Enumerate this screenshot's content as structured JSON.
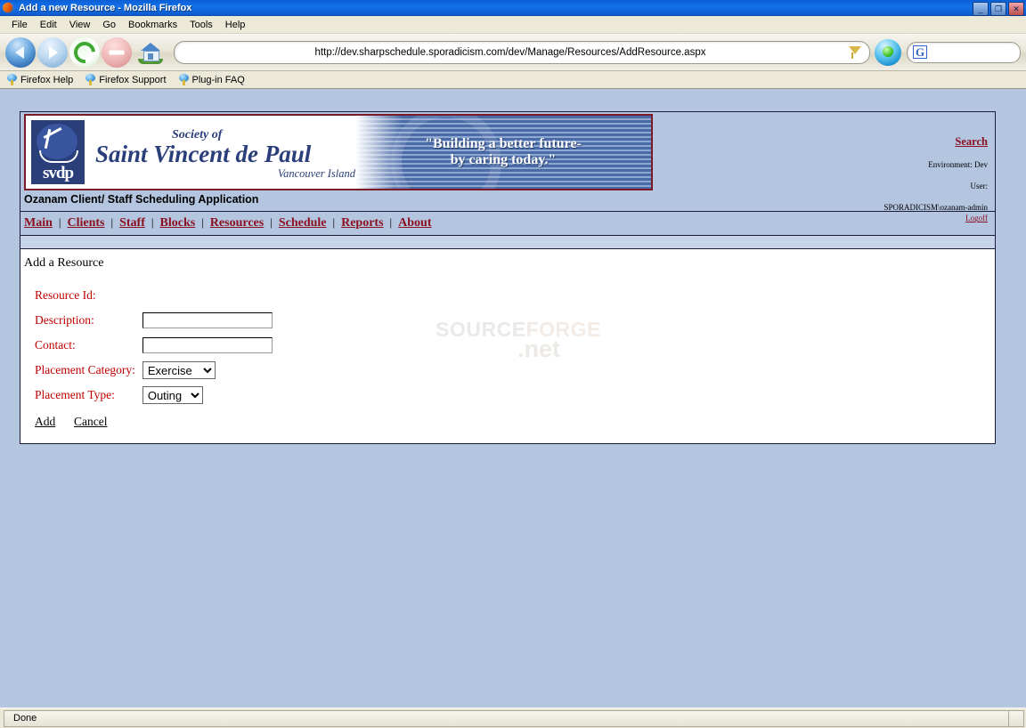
{
  "window": {
    "title": "Add a new Resource - Mozilla Firefox",
    "icon": "firefox-icon",
    "minimize": "_",
    "restore": "❐",
    "close": "✕"
  },
  "menubar": {
    "items": [
      "File",
      "Edit",
      "View",
      "Go",
      "Bookmarks",
      "Tools",
      "Help"
    ]
  },
  "toolbar": {
    "back": "back-button",
    "forward": "forward-button",
    "reload": "reload-button",
    "stop": "stop-button",
    "home": "home-button",
    "url": "http://dev.sharpschedule.sporadicism.com/dev/Manage/Resources/AddResource.aspx",
    "go_label": "Go",
    "search_engine": "G",
    "search_value": ""
  },
  "bookmarks": {
    "items": [
      "Firefox Help",
      "Firefox Support",
      "Plug-in FAQ"
    ]
  },
  "page": {
    "banner": {
      "logo_word": "svdp",
      "society": "Society of",
      "name": "Saint Vincent de Paul",
      "region": "Vancouver Island",
      "tagline_line1": "\"Building a better future-",
      "tagline_line2": "by caring today.\""
    },
    "header_right": {
      "search_link": "Search",
      "environment": "Environment: Dev",
      "user_label": "User:",
      "user_name": "SPORADICISM\\ozanam-admin",
      "logoff": "Logoff"
    },
    "app_title": "Ozanam Client/ Staff Scheduling Application",
    "nav": {
      "items": [
        "Main",
        "Clients",
        "Staff",
        "Blocks",
        "Resources",
        "Schedule",
        "Reports",
        "About"
      ],
      "separator": "|"
    },
    "form": {
      "title": "Add a Resource",
      "fields": [
        {
          "label": "Resource Id:",
          "type": "static",
          "value": ""
        },
        {
          "label": "Description:",
          "type": "text",
          "value": ""
        },
        {
          "label": "Contact:",
          "type": "text",
          "value": ""
        },
        {
          "label": "Placement Category:",
          "type": "select",
          "value": "Exercise"
        },
        {
          "label": "Placement Type:",
          "type": "select",
          "value": "Outing"
        }
      ],
      "add_label": "Add",
      "cancel_label": "Cancel"
    },
    "watermark": {
      "part1": "SOURCE",
      "part2": "FORGE",
      "part3": ".net"
    }
  },
  "statusbar": {
    "text": "Done"
  },
  "colors": {
    "titlebar_blue": "#0c63da",
    "page_blue": "#b4c5e0",
    "link_red": "#8a1020",
    "label_red": "#c00000",
    "banner_border": "#7a1b26",
    "logo_navy": "#2a3f7a"
  }
}
